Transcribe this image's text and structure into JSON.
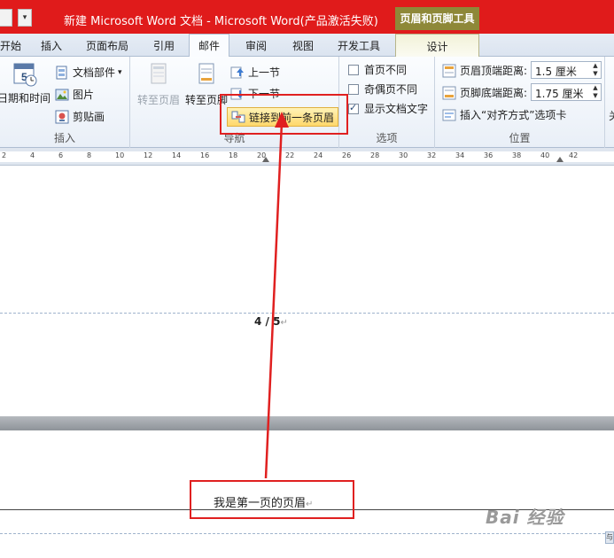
{
  "title_bar": {
    "title": "新建 Microsoft Word 文档 - Microsoft Word(产品激活失败)",
    "context_title": "页眉和页脚工具",
    "qat_dropdown": "▾"
  },
  "tabs": [
    "开始",
    "插入",
    "页面布局",
    "引用",
    "邮件",
    "审阅",
    "视图",
    "开发工具"
  ],
  "active_tab": "邮件",
  "design_tab": "设计",
  "ribbon": {
    "insert_group": {
      "label": "插入",
      "date_time": "日期和时间",
      "doc_parts": "文档部件",
      "doc_parts_arrow": "▾",
      "picture": "图片",
      "clip_art": "剪贴画"
    },
    "nav_group": {
      "label": "导航",
      "goto_header": "转至页眉",
      "goto_footer": "转至页脚",
      "previous": "上一节",
      "next": "下一节",
      "link_previous": "链接到前一条页眉"
    },
    "options_group": {
      "label": "选项",
      "first_page": "首页不同",
      "odd_even": "奇偶页不同",
      "show_text": "显示文档文字",
      "show_text_checked": true
    },
    "position_group": {
      "label": "位置",
      "header_top_label": "页眉顶端距离:",
      "header_top_value": "1.5 厘米",
      "footer_bottom_label": "页脚底端距离:",
      "footer_bottom_value": "1.75 厘米",
      "insert_align": "插入“对齐方式”选项卡"
    },
    "clipped_label": "关"
  },
  "ruler": {
    "ticks": [
      "2",
      "4",
      "6",
      "8",
      "10",
      "12",
      "14",
      "16",
      "18",
      "20",
      "22",
      "24",
      "26",
      "28",
      "30",
      "32",
      "34",
      "36",
      "38",
      "40",
      "42"
    ]
  },
  "document": {
    "page_number": "4 / 5",
    "paragraph_mark": "↵",
    "header_text": "我是第一页的页眉",
    "watermark": "Bai  经验",
    "corner_button": "与"
  },
  "colors": {
    "title_bar": "#e01b1b",
    "context_tab": "#8e8838",
    "highlight": "#e02020",
    "arrow": "#e02020"
  }
}
